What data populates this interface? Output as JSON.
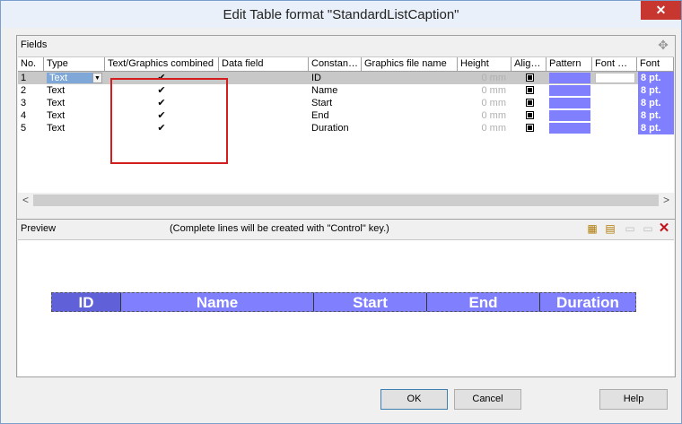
{
  "window": {
    "title": "Edit Table format \"StandardListCaption\"",
    "close_glyph": "✕"
  },
  "fields": {
    "label": "Fields",
    "columns": [
      "No.",
      "Type",
      "Text/Graphics combined",
      "Data field",
      "Constan…",
      "Graphics file name",
      "Height",
      "Alig…",
      "Pattern",
      "Font …",
      "Font"
    ],
    "rows": [
      {
        "no": "1",
        "type": "Text",
        "combined": "✔",
        "constant": "ID",
        "height": "0 mm",
        "font": "8 pt."
      },
      {
        "no": "2",
        "type": "Text",
        "combined": "✔",
        "constant": "Name",
        "height": "0 mm",
        "font": "8 pt."
      },
      {
        "no": "3",
        "type": "Text",
        "combined": "✔",
        "constant": "Start",
        "height": "0 mm",
        "font": "8 pt."
      },
      {
        "no": "4",
        "type": "Text",
        "combined": "✔",
        "constant": "End",
        "height": "0 mm",
        "font": "8 pt."
      },
      {
        "no": "5",
        "type": "Text",
        "combined": "✔",
        "constant": "Duration",
        "height": "0 mm",
        "font": "8 pt."
      }
    ],
    "selected_row": "1",
    "pattern_color": "#8080ff",
    "highlight_color": "#d21e1e"
  },
  "scroll": {
    "left_glyph": "<",
    "right_glyph": ">"
  },
  "preview": {
    "label": "Preview",
    "hint": "(Complete lines will be created with \"Control\" key.)",
    "tool_icons": [
      "new-line-icon",
      "edit-line-icon",
      "line-left-icon",
      "line-right-icon",
      "delete-icon"
    ],
    "caption_cells": [
      "ID",
      "Name",
      "Start",
      "End",
      "Duration"
    ]
  },
  "buttons": {
    "ok": "OK",
    "cancel": "Cancel",
    "help": "Help"
  }
}
